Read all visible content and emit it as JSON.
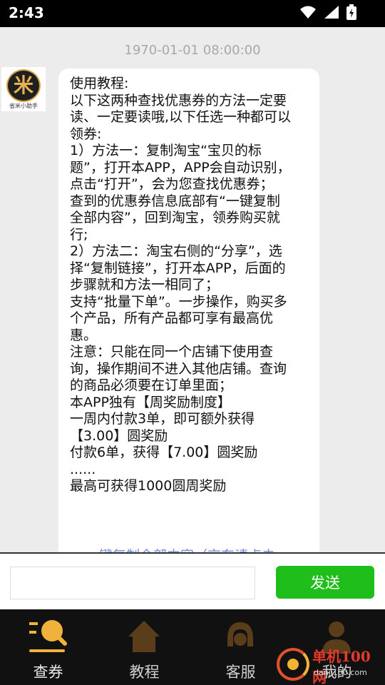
{
  "status_bar": {
    "time": "2:43",
    "icons": [
      "wifi-icon",
      "signal-icon",
      "battery-charging-icon"
    ]
  },
  "chat": {
    "timestamp": "1970-01-01 08:00:00",
    "avatar": {
      "glyph": "米",
      "caption": "省米小助手"
    },
    "message_lines": [
      "使用教程:",
      "以下这两种查找优惠券的方法一定要",
      "读、一定要读哦,以下任选一种都可以",
      "领券:",
      "1）方法一：复制淘宝“宝贝的标",
      "题”，打开本APP，APP会自动识别，",
      "点击“打开”，会为您查找优惠券；",
      "查到的优惠券信息底部有“一键复制",
      "全部内容”，回到淘宝，领券购买就",
      "行;",
      "2）方法二：淘宝右侧的“分享”，选",
      "择“复制链接”，打开本APP，后面的",
      "步骤就和方法一相同了；",
      "支持“批量下单”。一步操作，购买多",
      "个产品，所有产品都可享有最高优",
      "惠。",
      "注意：只能在同一个店铺下使用查",
      "询，操作期间不进入其他店铺。查询",
      "的商品必须要在订单里面；",
      "本APP独有【周奖励制度】",
      "一周内付款3单，即可额外获得",
      "【3.00】圆奖励",
      "付款6单，获得【7.00】圆奖励",
      "......",
      "最高可获得1000圆周奖励"
    ],
    "link_text": "一键复制全部内容（京东请点击"
  },
  "input": {
    "value": "",
    "placeholder": "",
    "send_label": "发送"
  },
  "tabs": [
    {
      "label": "查券",
      "icon": "search-list-icon",
      "active": true
    },
    {
      "label": "教程",
      "icon": "house-icon",
      "active": false
    },
    {
      "label": "客服",
      "icon": "headset-icon",
      "active": false
    },
    {
      "label": "我的",
      "icon": "person-icon",
      "active": false
    }
  ],
  "watermark": {
    "title": "单机100网",
    "url": "danji100.com"
  },
  "colors": {
    "send_button": "#1fbe1b",
    "tab_active": "#f0b23a",
    "tab_inactive_icon": "#5a3d1a",
    "link": "#6b8fd4"
  }
}
